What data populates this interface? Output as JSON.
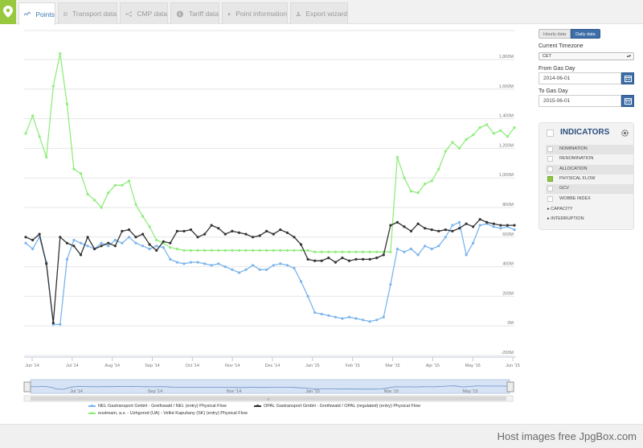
{
  "tabs": [
    {
      "label": "Points",
      "icon": "line-chart-icon",
      "active": true
    },
    {
      "label": "Transport data",
      "icon": "table-icon",
      "active": false
    },
    {
      "label": "CMP data",
      "icon": "network-icon",
      "active": false
    },
    {
      "label": "Tariff data",
      "icon": "euro-icon",
      "active": false
    },
    {
      "label": "Point information",
      "icon": "document-icon",
      "active": false
    },
    {
      "label": "Export wizard",
      "icon": "download-icon",
      "active": false
    }
  ],
  "panel": {
    "hourly_label": "Hourly data",
    "daily_label": "Daily data",
    "timezone_label": "Current Timezone",
    "timezone_value": "CET",
    "from_label": "From Gas Day",
    "from_value": "2014-06-01",
    "to_label": "To Gas Day",
    "to_value": "2015-06-01"
  },
  "indicators": {
    "title": "INDICATORS",
    "items": [
      {
        "label": "NOMINATION",
        "checked": false
      },
      {
        "label": "RENOMINATION",
        "checked": false
      },
      {
        "label": "ALLOCATION",
        "checked": false
      },
      {
        "label": "PHYSICAL FLOW",
        "checked": true
      },
      {
        "label": "GCV",
        "checked": false
      },
      {
        "label": "WOBBE INDEX",
        "checked": false
      }
    ],
    "groups": [
      "CAPACITY",
      "INTERRUPTION"
    ]
  },
  "chart_data": {
    "type": "line",
    "y_ticks": [
      "1,800M",
      "1,600M",
      "1,400M",
      "1,200M",
      "1,000M",
      "800M",
      "600M",
      "400M",
      "200M",
      "0M",
      "-200M"
    ],
    "ylim": [
      -200,
      1900
    ],
    "x_ticks": [
      "Jun '14",
      "Jul '14",
      "Aug '14",
      "Sep '14",
      "Oct '14",
      "Nov '14",
      "Dec '14",
      "Jan '15",
      "Feb '15",
      "Mar '15",
      "Apr '15",
      "May '15",
      "Jun '15"
    ],
    "navigator_ticks": [
      "Jul '14",
      "Sep '14",
      "Nov '14",
      "Jan '15",
      "Mar '15",
      "May '15"
    ],
    "series": [
      {
        "name": "NEL Gastransport GmbH - Greifswald / NEL (entry) Physical Flow",
        "color": "#7cb5ec",
        "values": [
          560,
          520,
          600,
          430,
          10,
          10,
          450,
          580,
          560,
          540,
          520,
          560,
          540,
          580,
          560,
          600,
          560,
          540,
          520,
          540,
          530,
          450,
          430,
          420,
          430,
          430,
          420,
          410,
          420,
          400,
          380,
          360,
          380,
          410,
          380,
          380,
          410,
          420,
          410,
          390,
          300,
          200,
          90,
          80,
          70,
          60,
          50,
          60,
          50,
          40,
          30,
          40,
          60,
          280,
          520,
          500,
          520,
          480,
          540,
          520,
          540,
          600,
          680,
          700,
          480,
          560,
          680,
          690,
          670,
          660,
          670,
          650
        ]
      },
      {
        "name": "OPAL Gastransport GmbH - Greifswald / OPAL (regulated) (entry) Physical Flow",
        "color": "#333333",
        "values": [
          600,
          580,
          620,
          420,
          20,
          600,
          560,
          540,
          480,
          600,
          520,
          540,
          560,
          540,
          640,
          650,
          600,
          620,
          550,
          510,
          570,
          560,
          640,
          640,
          650,
          600,
          620,
          680,
          660,
          620,
          640,
          630,
          620,
          600,
          610,
          640,
          620,
          650,
          630,
          600,
          550,
          450,
          440,
          440,
          460,
          430,
          460,
          440,
          450,
          450,
          450,
          460,
          480,
          680,
          700,
          670,
          640,
          690,
          660,
          650,
          640,
          650,
          640,
          660,
          690,
          670,
          720,
          700,
          690,
          680,
          680,
          680
        ]
      },
      {
        "name": "eustream, a.s. - Uzhgorod (UA) - Velké Kapušany (SK) (entry) Physical Flow",
        "color": "#90ed7d",
        "values": [
          1300,
          1420,
          1280,
          1140,
          1620,
          1840,
          1500,
          1060,
          1030,
          890,
          850,
          800,
          900,
          950,
          950,
          980,
          820,
          740,
          670,
          580,
          560,
          530,
          520,
          510,
          510,
          510,
          510,
          510,
          510,
          510,
          510,
          510,
          510,
          510,
          510,
          510,
          510,
          510,
          510,
          510,
          510,
          510,
          500,
          500,
          500,
          500,
          500,
          500,
          500,
          500,
          500,
          500,
          500,
          500,
          1140,
          1000,
          910,
          900,
          960,
          980,
          1060,
          1180,
          1240,
          1200,
          1260,
          1290,
          1340,
          1360,
          1300,
          1320,
          1280,
          1340
        ]
      }
    ]
  },
  "footer_text": "Host images free JpgBox.com"
}
